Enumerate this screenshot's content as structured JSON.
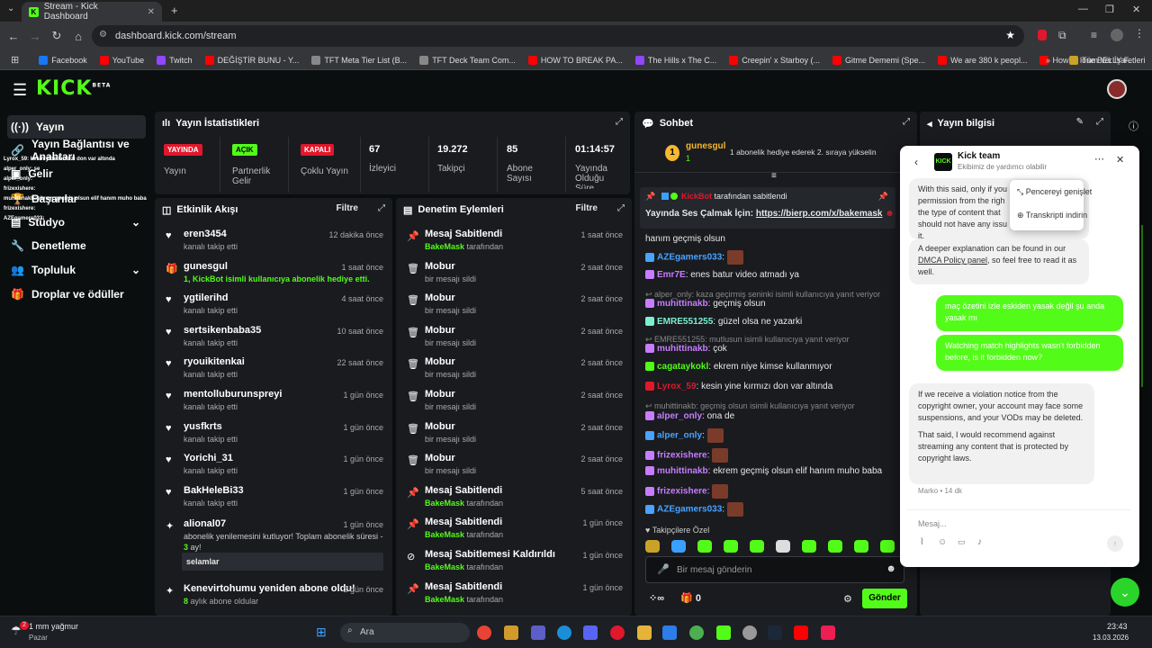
{
  "browser": {
    "tab_title": "Stream - Kick Dashboard",
    "url": "dashboard.kick.com/stream",
    "bookmarks": [
      {
        "label": "Facebook",
        "color": "#1877f2"
      },
      {
        "label": "YouTube",
        "color": "#ff0000"
      },
      {
        "label": "Twitch",
        "color": "#9146ff"
      },
      {
        "label": "DEĞİŞTİR BUNU - Y...",
        "color": "#ff0000"
      },
      {
        "label": "TFT Meta Tier List (B...",
        "color": "#888888"
      },
      {
        "label": "TFT Deck Team Com...",
        "color": "#888888"
      },
      {
        "label": "HOW TO BREAK PA...",
        "color": "#ff0000"
      },
      {
        "label": "The Hills x The C...",
        "color": "#9146ff"
      },
      {
        "label": "Creepin' x Starboy (...",
        "color": "#ff0000"
      },
      {
        "label": "Gitme Dememi (Spe...",
        "color": "#ff0000"
      },
      {
        "label": "We are 380 k peopl...",
        "color": "#ff0000"
      },
      {
        "label": "How to lose BELLY F...",
        "color": "#ff0000"
      }
    ],
    "all_bookmarks": "Tüm Yer İşaretleri"
  },
  "kick": {
    "logo": "KICK",
    "logo_sup": "BETA"
  },
  "sidebar": {
    "items": [
      {
        "label": "Yayın",
        "icon": "broadcast-icon"
      },
      {
        "label": "Yayın Bağlantısı ve Anahtarı",
        "icon": "link-icon"
      },
      {
        "label": "Gelir",
        "icon": "money-icon"
      },
      {
        "label": "Başarılar",
        "icon": "trophy-icon"
      },
      {
        "label": "Stüdyo",
        "icon": "studio-icon"
      },
      {
        "label": "Denetleme",
        "icon": "wrench-icon"
      },
      {
        "label": "Topluluk",
        "icon": "people-icon"
      },
      {
        "label": "Droplar ve ödüller",
        "icon": "gift-icon"
      }
    ],
    "overlay_lines": [
      "Lyrox_59: kesin yine kırmızı don var altında",
      "alper_only: se",
      "alper_only:",
      "frizexishere:",
      "muhittinakb: ekrem geçmiş olsun elif hanım muho baba",
      "frizexishere:",
      "AZEgamers033:"
    ]
  },
  "stats": {
    "title": "Yayın İstatistikleri",
    "items": [
      {
        "badge": "YAYINDA",
        "badge_color": "#e0182c",
        "label": "Yayın"
      },
      {
        "badge": "AÇIK",
        "badge_color": "#53fc18",
        "label": "Partnerlik Gelir"
      },
      {
        "badge": "KAPALI",
        "badge_color": "#e0182c",
        "label": "Çoklu Yayın"
      },
      {
        "value": "67",
        "label": "İzleyici"
      },
      {
        "value": "19.272",
        "label": "Takipçi"
      },
      {
        "value": "85",
        "label": "Abone Sayısı"
      },
      {
        "value": "01:14:57",
        "label": "Yayında Olduğu Süre"
      }
    ]
  },
  "activity": {
    "title": "Etkinlik Akışı",
    "filter": "Filtre",
    "rows": [
      {
        "name": "eren3454",
        "sub": "kanalı takip etti",
        "time": "12 dakika önce",
        "icon": "heart-icon"
      },
      {
        "name": "gunesgul",
        "sub": "1, KickBot isimli kullanıcıya abonelik hediye etti.",
        "time": "1 saat önce",
        "icon": "gift-icon"
      },
      {
        "name": "ygtilerihd",
        "sub": "kanalı takip etti",
        "time": "4 saat önce",
        "icon": "heart-icon"
      },
      {
        "name": "sertsikenbaba35",
        "sub": "kanalı takip etti",
        "time": "10 saat önce",
        "icon": "heart-icon"
      },
      {
        "name": "ryouikitenkai",
        "sub": "kanalı takip etti",
        "time": "22 saat önce",
        "icon": "heart-icon"
      },
      {
        "name": "mentolluburunspreyi",
        "sub": "kanalı takip etti",
        "time": "1 gün önce",
        "icon": "heart-icon"
      },
      {
        "name": "yusfkrts",
        "sub": "kanalı takip etti",
        "time": "1 gün önce",
        "icon": "heart-icon"
      },
      {
        "name": "Yorichi_31",
        "sub": "kanalı takip etti",
        "time": "1 gün önce",
        "icon": "heart-icon"
      },
      {
        "name": "BakHeleBi33",
        "sub": "kanalı takip etti",
        "time": "1 gün önce",
        "icon": "heart-icon"
      }
    ],
    "resub": {
      "name": "alional07",
      "time": "1 gün önce",
      "text": "abonelik yenilemesini kutluyor! Toplam abonelik süresi - ",
      "months": "3",
      "suffix": "ay!",
      "message": "selamlar"
    },
    "last": {
      "name": "Kenevirtohumu yeniden abone oldu!",
      "months": "8",
      "sub": "aylık abone oldular",
      "time": "2 gün önce"
    }
  },
  "moderation": {
    "title": "Denetim Eylemleri",
    "filter": "Filtre",
    "rows": [
      {
        "name": "Mesaj Sabitlendi",
        "by": "BakeMask",
        "byrest": " tarafından",
        "time": "1 saat önce",
        "icon": "pin-icon"
      },
      {
        "name": "Mobur",
        "sub": "bir mesajı sildi",
        "time": "2 saat önce",
        "icon": "trash-icon"
      },
      {
        "name": "Mobur",
        "sub": "bir mesajı sildi",
        "time": "2 saat önce",
        "icon": "trash-icon"
      },
      {
        "name": "Mobur",
        "sub": "bir mesajı sildi",
        "time": "2 saat önce",
        "icon": "trash-icon"
      },
      {
        "name": "Mobur",
        "sub": "bir mesajı sildi",
        "time": "2 saat önce",
        "icon": "trash-icon"
      },
      {
        "name": "Mobur",
        "sub": "bir mesajı sildi",
        "time": "2 saat önce",
        "icon": "trash-icon"
      },
      {
        "name": "Mobur",
        "sub": "bir mesajı sildi",
        "time": "2 saat önce",
        "icon": "trash-icon"
      },
      {
        "name": "Mobur",
        "sub": "bir mesajı sildi",
        "time": "2 saat önce",
        "icon": "trash-icon"
      },
      {
        "name": "Mesaj Sabitlendi",
        "by": "BakeMask",
        "byrest": " tarafından",
        "time": "5 saat önce",
        "icon": "pin-icon"
      },
      {
        "name": "Mesaj Sabitlendi",
        "by": "BakeMask",
        "byrest": " tarafından",
        "time": "1 gün önce",
        "icon": "pin-icon"
      },
      {
        "name": "Mesaj Sabitlemesi Kaldırıldı",
        "by": "BakeMask",
        "byrest": " tarafından",
        "time": "1 gün önce",
        "icon": "unpin-icon"
      },
      {
        "name": "Mesaj Sabitlendi",
        "by": "BakeMask",
        "byrest": " tarafından",
        "time": "1 gün önce",
        "icon": "pin-icon"
      }
    ]
  },
  "chat": {
    "title": "Sohbet",
    "gifter": {
      "rank": "1",
      "name": "gunesgul",
      "count": "1",
      "text": "1 abonelik hediye ederek 2. sıraya yükselin"
    },
    "pinned": {
      "by": "KickBot",
      "byrest": " tarafından sabitlendi",
      "text": "Yayında Ses Çalmak İçin: ",
      "link": "https://bierp.com/x/bakemask"
    },
    "lines": [
      {
        "type": "msg",
        "user": "",
        "text": "hanım geçmiş olsun",
        "emote": false
      },
      {
        "type": "msg",
        "user": "AZEgamers033",
        "ucolor": "#4aa3ff",
        "text": ":",
        "emote": true
      },
      {
        "type": "msg",
        "user": "Emr7E",
        "ucolor": "#c77dff",
        "text": ": enes batur video atmadı ya",
        "emote": false
      },
      {
        "type": "reply",
        "text": "alper_only: kaza geçirmiş seninki isimli kullanıcıya yanıt veriyor"
      },
      {
        "type": "msg",
        "user": "muhittinakb",
        "ucolor": "#c77dff",
        "text": ": geçmiş olsun",
        "emote": false
      },
      {
        "type": "msg",
        "user": "EMRE551255",
        "ucolor": "#7af0d0",
        "text": ": güzel olsa ne yazarki",
        "emote": false
      },
      {
        "type": "reply",
        "text": "EMRE551255: mutlusun isimli kullanıcıya yanıt veriyor"
      },
      {
        "type": "msg",
        "user": "muhittinakb",
        "ucolor": "#c77dff",
        "text": ": çok",
        "emote": false
      },
      {
        "type": "msg",
        "user": "cagataykokl",
        "ucolor": "#53fc18",
        "text": ": ekrem niye kimse kullanmıyor",
        "emote": false
      },
      {
        "type": "msg",
        "user": "Lyrox_59",
        "ucolor": "#e0182c",
        "text": ": kesin yine kırmızı don var altında",
        "emote": false
      },
      {
        "type": "reply",
        "text": "muhittinakb: geçmiş olsun isimli kullanıcıya yanıt veriyor"
      },
      {
        "type": "msg",
        "user": "alper_only",
        "ucolor": "#c77dff",
        "text": ": ona de",
        "emote": false
      },
      {
        "type": "msg",
        "user": "alper_only",
        "ucolor": "#4aa3ff",
        "text": ":",
        "emote": true
      },
      {
        "type": "msg",
        "user": "frizexishere",
        "ucolor": "#c77dff",
        "text": ":",
        "emote": true
      },
      {
        "type": "msg",
        "user": "muhittinakb",
        "ucolor": "#c77dff",
        "text": ": ekrem geçmiş olsun elif hanım muho baba",
        "emote": false
      },
      {
        "type": "msg",
        "user": "frizexishere",
        "ucolor": "#c77dff",
        "text": ":",
        "emote": true
      },
      {
        "type": "msg",
        "user": "AZEgamers033",
        "ucolor": "#4aa3ff",
        "text": ":",
        "emote": true
      }
    ],
    "followers_only": "Takipçilere Özel",
    "input_placeholder": "Bir mesaj gönderin",
    "counter": "0",
    "send": "Gönder",
    "infinity": "∞"
  },
  "info": {
    "title": "Yayın bilgisi"
  },
  "support": {
    "title": "Kick team",
    "subtitle": "Ekibimiz de yardımcı olabilir",
    "menu": [
      "Pencereyi genişlet",
      "Transkripti indirin"
    ],
    "msg1a": "With this said, only if you",
    "msg1b": "permission from the righ",
    "msg1c": "the type of content that",
    "msg1d": "should not have any issu",
    "msg1e": "it.",
    "msg2": "A deeper explanation can be found in our",
    "msg2link": "DMCA Policy panel",
    "msg2b": ", so feel free to read it as well.",
    "user1": "maç özetini izle eskiden yasak değil şu anda yasak mı",
    "user2": "Watching match highlights wasn't forbidden before, is it forbidden now?",
    "reply1": "If we receive a violation notice from the copyright owner, your account may face some suspensions, and your VODs may be deleted.",
    "reply2": "That said, I would recommend against streaming any content that is protected by copyright laws.",
    "author": "Marko • 14 dk",
    "placeholder": "Mesaj..."
  },
  "taskbar": {
    "weather": "1 mm yağmur",
    "weather_sub": "Pazar",
    "search": "Ara",
    "time": "23:43",
    "date": "13.03.2026",
    "badge": "2"
  }
}
